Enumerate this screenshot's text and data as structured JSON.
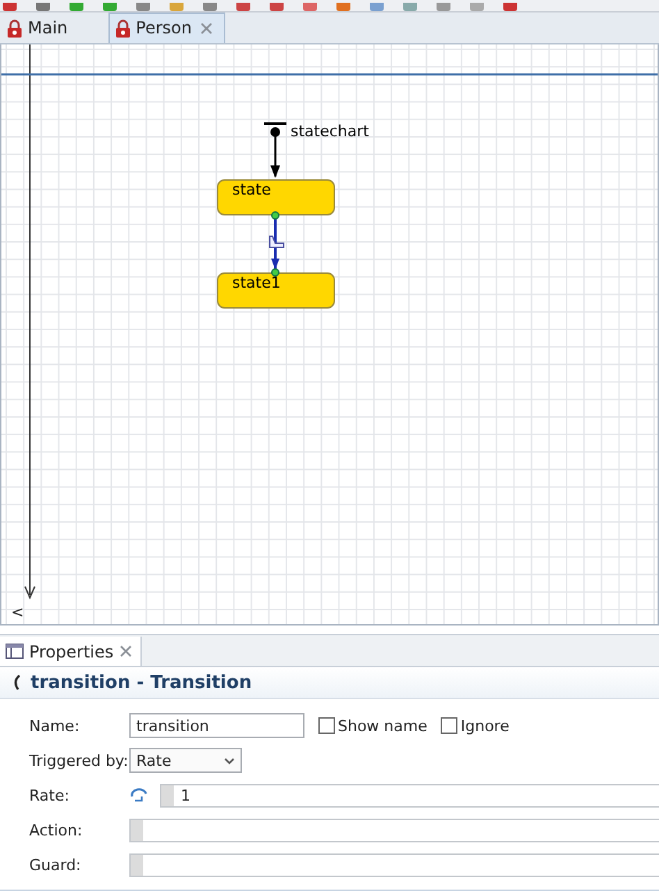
{
  "editor_tabs": [
    {
      "label": "Main",
      "selected": false,
      "closable": false
    },
    {
      "label": "Person",
      "selected": true,
      "closable": true
    }
  ],
  "diagram": {
    "statechart_label": "statechart",
    "states": [
      {
        "label": "state"
      },
      {
        "label": "state1"
      }
    ],
    "scroll_left": "<"
  },
  "properties_tab": {
    "label": "Properties"
  },
  "panel_title": "transition - Transition",
  "form": [
    {
      "kind": "text",
      "label": "Name:",
      "value": "transition",
      "checkboxes": [
        {
          "label": "Show name",
          "checked": false
        },
        {
          "label": "Ignore",
          "checked": false
        }
      ]
    },
    {
      "kind": "select",
      "label": "Triggered by:",
      "value": "Rate"
    },
    {
      "kind": "code",
      "label": "Rate:",
      "value": "1",
      "icon": true
    },
    {
      "kind": "code",
      "label": "Action:"
    },
    {
      "kind": "code",
      "label": "Guard:"
    }
  ]
}
